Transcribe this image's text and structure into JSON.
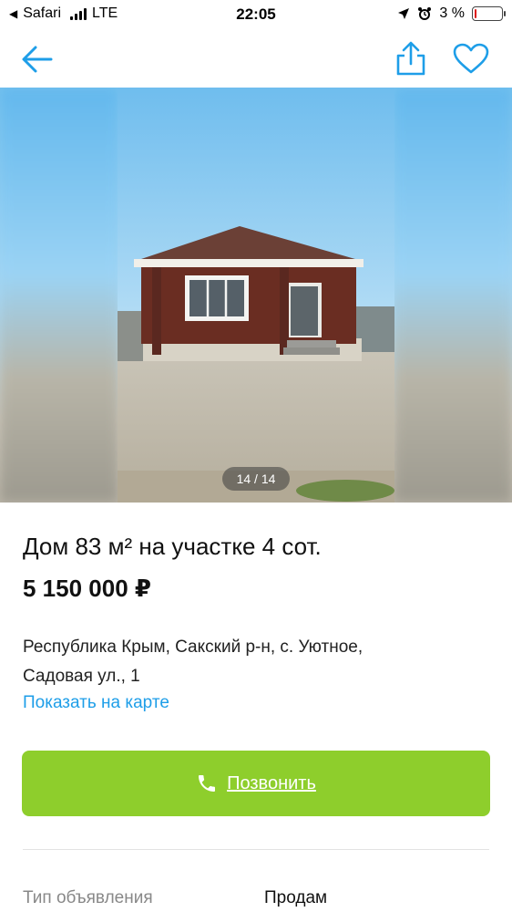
{
  "status_bar": {
    "back_app": "Safari",
    "network": "LTE",
    "time": "22:05",
    "battery_percent": "3 %",
    "battery_level": 0.03
  },
  "nav": {
    "back_icon": "arrow-left-icon",
    "share_icon": "share-icon",
    "favorite_icon": "heart-icon",
    "accent_color": "#1e9ee8"
  },
  "gallery": {
    "counter": "14 / 14",
    "current": 14,
    "total": 14
  },
  "listing": {
    "title": "Дом 83 м² на участке 4 сот.",
    "price": "5 150 000 ₽",
    "address_line1": "Республика Крым, Сакский р-н, с. Уютное,",
    "address_line2": "Садовая ул., 1",
    "map_link": "Показать на карте"
  },
  "call_button": {
    "label": "Позвонить",
    "icon": "phone-icon",
    "color": "#8ece2c"
  },
  "params": [
    {
      "label": "Тип объявления",
      "value": "Продам"
    }
  ]
}
